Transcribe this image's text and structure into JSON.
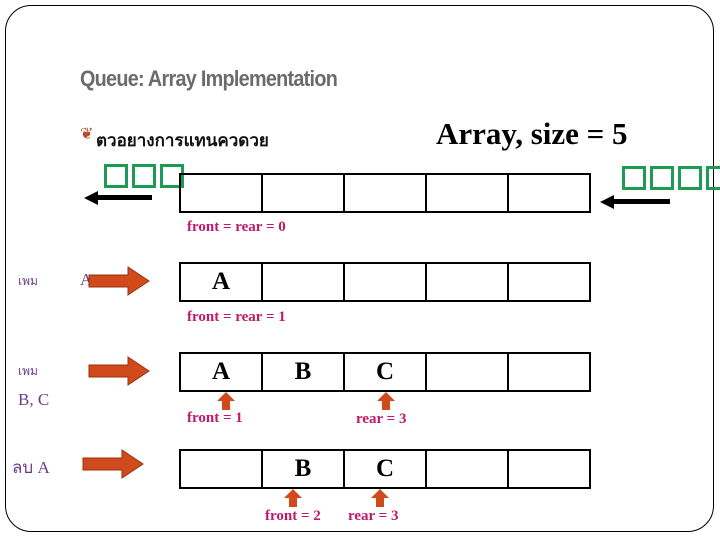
{
  "slide": {
    "title": "Queue: Array Implementation",
    "bullet_icon": "ornament-bullet-icon",
    "bullet_text": "ตวอยางการแทนควดวย",
    "left_glyphs": "□□□",
    "right_glyphs": "□□□□",
    "array_size_label": "Array, size = 5",
    "colors": {
      "title": "#6b6b6b",
      "pointer_label": "#c0186c",
      "side_label": "#6a3d8c",
      "arrow": "#d04a1c",
      "glyph": "#1f9a52"
    }
  },
  "rows": [
    {
      "side_label": "",
      "side_sub": "",
      "cells": [
        "",
        "",
        "",
        "",
        ""
      ],
      "labels": [
        {
          "text": "front = rear = 0"
        }
      ]
    },
    {
      "side_label": "เพม",
      "side_sub": "A",
      "cells": [
        "A",
        "",
        "",
        "",
        ""
      ],
      "labels": [
        {
          "text": "front = rear = 1"
        }
      ]
    },
    {
      "side_label": "เพม",
      "side_sub": "B, C",
      "cells": [
        "A",
        "B",
        "C",
        "",
        ""
      ],
      "labels": [
        {
          "text": "front = 1"
        },
        {
          "text": "rear = 3"
        }
      ]
    },
    {
      "side_label": "ลบ A",
      "side_sub": "",
      "cells": [
        "",
        "B",
        "C",
        "",
        ""
      ],
      "labels": [
        {
          "text": "front = 2"
        },
        {
          "text": "rear = 3"
        }
      ]
    }
  ]
}
